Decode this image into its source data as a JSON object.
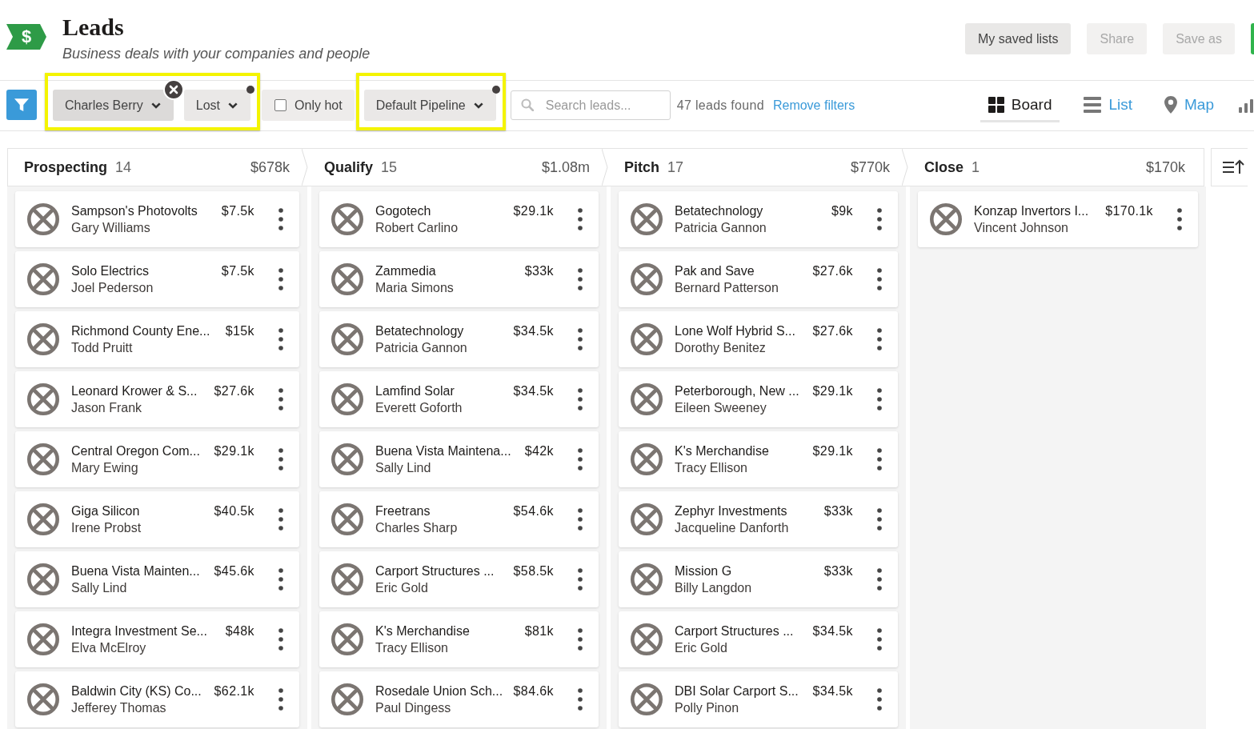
{
  "header": {
    "logo": "$",
    "title": "Leads",
    "subtitle": "Business deals with your companies and people",
    "buttons": [
      {
        "label": "My saved lists",
        "disabled": false
      },
      {
        "label": "Share",
        "disabled": true
      },
      {
        "label": "Save as",
        "disabled": true
      }
    ]
  },
  "filter_bar": {
    "groups": [
      {
        "highlighted": true,
        "items": [
          {
            "kind": "dropdown",
            "label": "Charles Berry",
            "active": true,
            "clearable": true,
            "changed": false
          },
          {
            "kind": "dropdown",
            "label": "Lost",
            "active": false,
            "clearable": false,
            "changed": true
          }
        ]
      },
      {
        "highlighted": false,
        "items": [
          {
            "kind": "checkbox",
            "label": "Only hot",
            "checked": false
          }
        ]
      },
      {
        "highlighted": true,
        "items": [
          {
            "kind": "dropdown",
            "label": "Default Pipeline",
            "active": false,
            "clearable": false,
            "changed": true
          }
        ]
      }
    ],
    "search": {
      "placeholder": "Search leads..."
    },
    "result_count": "47 leads found",
    "remove_filters": "Remove filters",
    "views": [
      {
        "kind": "board",
        "label": "Board",
        "selected": true
      },
      {
        "kind": "list",
        "label": "List",
        "selected": false
      },
      {
        "kind": "map",
        "label": "Map",
        "selected": false
      },
      {
        "kind": "chart",
        "selected": false
      }
    ]
  },
  "board": {
    "columns": [
      {
        "title": "Prospecting",
        "count": "14",
        "total": "$678k",
        "cards": [
          {
            "name": "Sampson's Photovolts",
            "contact": "Gary Williams",
            "value": "$7.5k"
          },
          {
            "name": "Solo Electrics",
            "contact": "Joel Pederson",
            "value": "$7.5k"
          },
          {
            "name": "Richmond County Ene...",
            "contact": "Todd Pruitt",
            "value": "$15k"
          },
          {
            "name": "Leonard Krower & S...",
            "contact": "Jason Frank",
            "value": "$27.6k"
          },
          {
            "name": "Central Oregon Com...",
            "contact": "Mary Ewing",
            "value": "$29.1k"
          },
          {
            "name": "Giga Silicon",
            "contact": "Irene Probst",
            "value": "$40.5k"
          },
          {
            "name": "Buena Vista Mainten...",
            "contact": "Sally Lind",
            "value": "$45.6k"
          },
          {
            "name": "Integra Investment Se...",
            "contact": "Elva McElroy",
            "value": "$48k"
          },
          {
            "name": "Baldwin City (KS) Co...",
            "contact": "Jefferey Thomas",
            "value": "$62.1k"
          }
        ]
      },
      {
        "title": "Qualify",
        "count": "15",
        "total": "$1.08m",
        "cards": [
          {
            "name": "Gogotech",
            "contact": "Robert Carlino",
            "value": "$29.1k"
          },
          {
            "name": "Zammedia",
            "contact": "Maria Simons",
            "value": "$33k"
          },
          {
            "name": "Betatechnology",
            "contact": "Patricia Gannon",
            "value": "$34.5k"
          },
          {
            "name": "Lamfind Solar",
            "contact": "Everett Goforth",
            "value": "$34.5k"
          },
          {
            "name": "Buena Vista Maintena...",
            "contact": "Sally Lind",
            "value": "$42k"
          },
          {
            "name": "Freetrans",
            "contact": "Charles Sharp",
            "value": "$54.6k"
          },
          {
            "name": "Carport Structures ...",
            "contact": "Eric Gold",
            "value": "$58.5k"
          },
          {
            "name": "K's Merchandise",
            "contact": "Tracy Ellison",
            "value": "$81k"
          },
          {
            "name": "Rosedale Union Sch...",
            "contact": "Paul Dingess",
            "value": "$84.6k"
          }
        ]
      },
      {
        "title": "Pitch",
        "count": "17",
        "total": "$770k",
        "cards": [
          {
            "name": "Betatechnology",
            "contact": "Patricia Gannon",
            "value": "$9k"
          },
          {
            "name": "Pak and Save",
            "contact": "Bernard Patterson",
            "value": "$27.6k"
          },
          {
            "name": "Lone Wolf Hybrid S...",
            "contact": "Dorothy Benitez",
            "value": "$27.6k"
          },
          {
            "name": "Peterborough, New ...",
            "contact": "Eileen Sweeney",
            "value": "$29.1k"
          },
          {
            "name": "K's Merchandise",
            "contact": "Tracy Ellison",
            "value": "$29.1k"
          },
          {
            "name": "Zephyr Investments",
            "contact": "Jacqueline Danforth",
            "value": "$33k"
          },
          {
            "name": "Mission G",
            "contact": "Billy Langdon",
            "value": "$33k"
          },
          {
            "name": "Carport Structures ...",
            "contact": "Eric Gold",
            "value": "$34.5k"
          },
          {
            "name": "DBI Solar Carport S...",
            "contact": "Polly Pinon",
            "value": "$34.5k"
          }
        ]
      },
      {
        "title": "Close",
        "count": "1",
        "total": "$170k",
        "cards": [
          {
            "name": "Konzap Invertors I...",
            "contact": "Vincent Johnson",
            "value": "$170.1k"
          }
        ]
      }
    ]
  }
}
